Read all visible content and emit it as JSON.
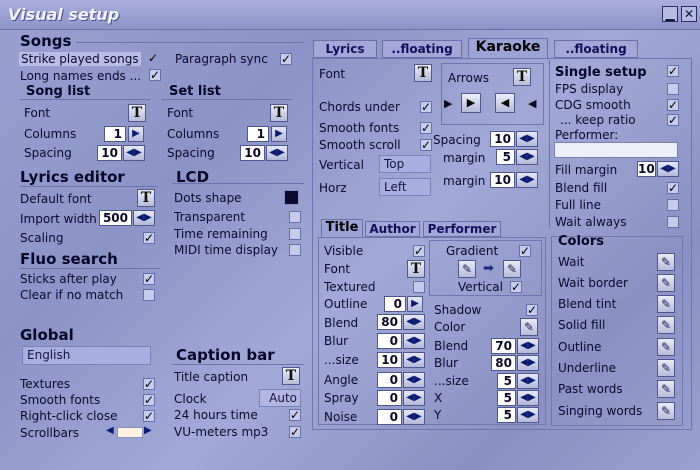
{
  "window": {
    "title": "Visual setup"
  },
  "songs": {
    "heading": "Songs",
    "strike": "Strike played songs",
    "long_names": "Long names ends ...",
    "paragraph_sync": "Paragraph sync",
    "song_list": {
      "heading": "Song list",
      "font": "Font",
      "columns": "Columns",
      "columns_val": "1",
      "spacing": "Spacing",
      "spacing_val": "10"
    },
    "set_list": {
      "heading": "Set list",
      "font": "Font",
      "columns": "Columns",
      "columns_val": "1",
      "spacing": "Spacing",
      "spacing_val": "10"
    }
  },
  "lyrics_editor": {
    "heading": "Lyrics editor",
    "default_font": "Default font",
    "import_width": "Import width",
    "import_width_val": "500",
    "scaling": "Scaling"
  },
  "lcd": {
    "heading": "LCD",
    "dots_shape": "Dots shape",
    "transparent": "Transparent",
    "time_remaining": "Time remaining",
    "midi_time": "MIDI time display"
  },
  "fluo": {
    "heading": "Fluo search",
    "sticks": "Sticks after play",
    "clear": "Clear if no match"
  },
  "global": {
    "heading": "Global",
    "language": "English",
    "textures": "Textures",
    "smooth_fonts": "Smooth fonts",
    "right_click": "Right-click close",
    "scrollbars": "Scrollbars"
  },
  "caption": {
    "heading": "Caption bar",
    "title_caption": "Title caption",
    "clock": "Clock",
    "clock_val": "Auto",
    "hours24": "24 hours time",
    "vu": "VU-meters mp3"
  },
  "tabs": [
    {
      "label": "Lyrics"
    },
    {
      "label": "..floating"
    },
    {
      "label": "Karaoke"
    },
    {
      "label": "..floating"
    }
  ],
  "karaoke": {
    "font": "Font",
    "arrows": "Arrows",
    "chords_under": "Chords under",
    "smooth_fonts": "Smooth fonts",
    "smooth_scroll": "Smooth scroll",
    "vertical": "Vertical",
    "vertical_val": "Top",
    "horz": "Horz",
    "horz_val": "Left",
    "spacing": "Spacing",
    "spacing_val": "10",
    "margin": "margin",
    "margin_val": "5",
    "margin2": "margin",
    "margin2_val": "10"
  },
  "right": {
    "single_setup": "Single setup",
    "fps": "FPS display",
    "cdg": "CDG smooth",
    "keep_ratio": "... keep ratio",
    "performer": "Performer:",
    "fill_margin": "Fill margin",
    "fill_margin_val": "10",
    "blend_fill": "Blend fill",
    "full_line": "Full line",
    "wait_always": "Wait always"
  },
  "subtabs": [
    {
      "label": "Title"
    },
    {
      "label": "Author"
    },
    {
      "label": "Performer"
    }
  ],
  "title_panel": {
    "visible": "Visible",
    "font": "Font",
    "textured": "Textured",
    "outline": "Outline",
    "outline_val": "0",
    "blend": "Blend",
    "blend_val": "80",
    "blur": "Blur",
    "blur_val": "0",
    "size": "...size",
    "size_val": "10",
    "angle": "Angle",
    "angle_val": "0",
    "spray": "Spray",
    "spray_val": "0",
    "noise": "Noise",
    "noise_val": "0",
    "gradient": "Gradient",
    "vertical": "Vertical",
    "shadow": "Shadow",
    "color": "Color",
    "sblend": "Blend",
    "sblend_val": "70",
    "sblur": "Blur",
    "sblur_val": "80",
    "ssize": "...size",
    "ssize_val": "5",
    "x": "X",
    "x_val": "5",
    "y": "Y",
    "y_val": "5"
  },
  "colors": {
    "heading": "Colors",
    "items": [
      "Wait",
      "Wait border",
      "Blend tint",
      "Solid fill",
      "Outline",
      "Underline",
      "Past words",
      "Singing words"
    ]
  }
}
